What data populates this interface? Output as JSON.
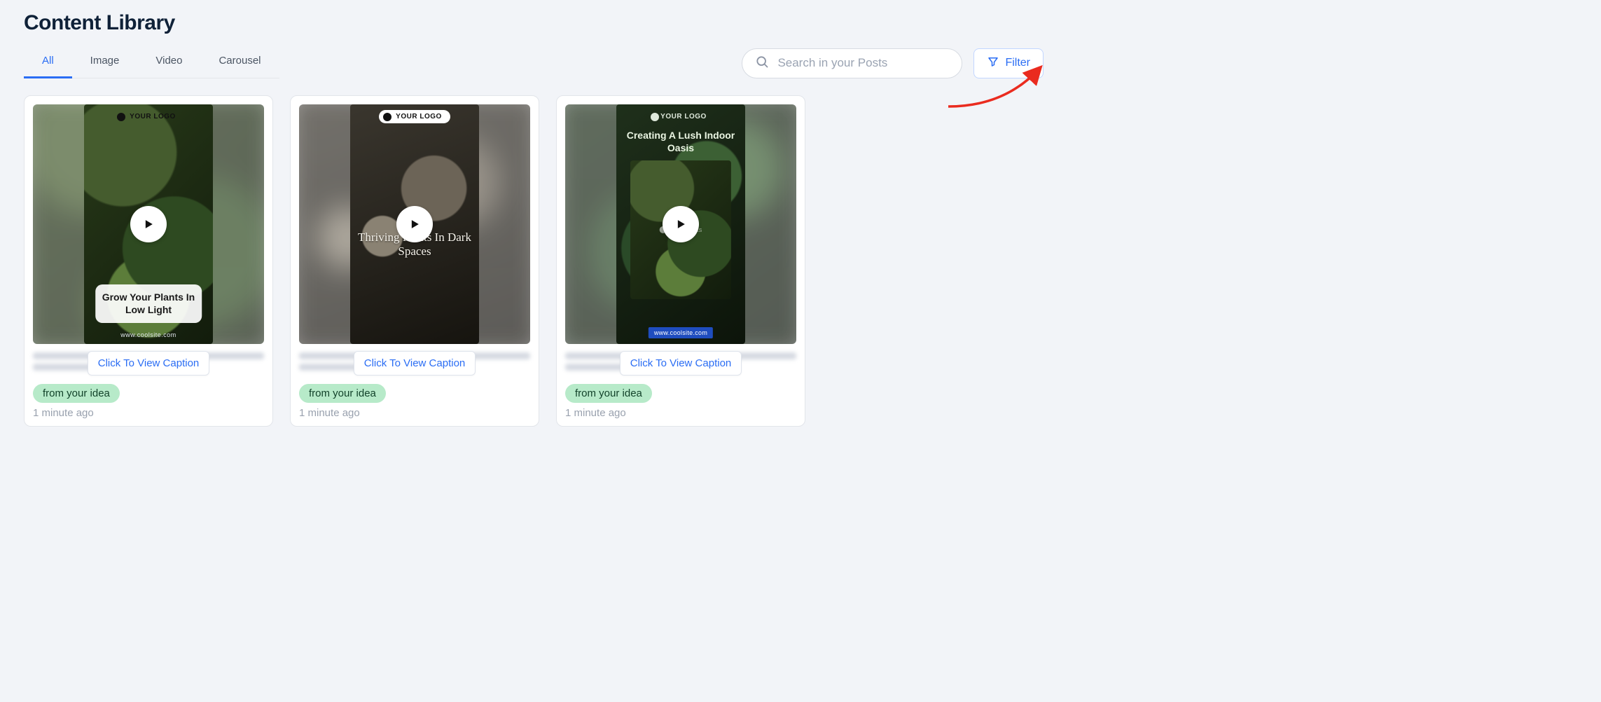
{
  "page": {
    "title": "Content Library"
  },
  "tabs": {
    "all": "All",
    "image": "Image",
    "video": "Video",
    "carousel": "Carousel"
  },
  "search": {
    "placeholder": "Search in your Posts"
  },
  "filter": {
    "label": "Filter"
  },
  "common": {
    "caption_button_label": "Click To View Caption",
    "source_tag": "from your idea",
    "logo_text": "YOUR LOGO",
    "watermark": "Storyblocks"
  },
  "cards": [
    {
      "headline": "Grow Your Plants In Low Light",
      "site": "www.coolsite.com",
      "timestamp": "1 minute ago"
    },
    {
      "headline": "Thriving Plants In Dark Spaces",
      "site": "",
      "timestamp": "1 minute ago"
    },
    {
      "headline": "Creating A Lush Indoor Oasis",
      "site": "www.coolsite.com",
      "timestamp": "1 minute ago"
    }
  ]
}
